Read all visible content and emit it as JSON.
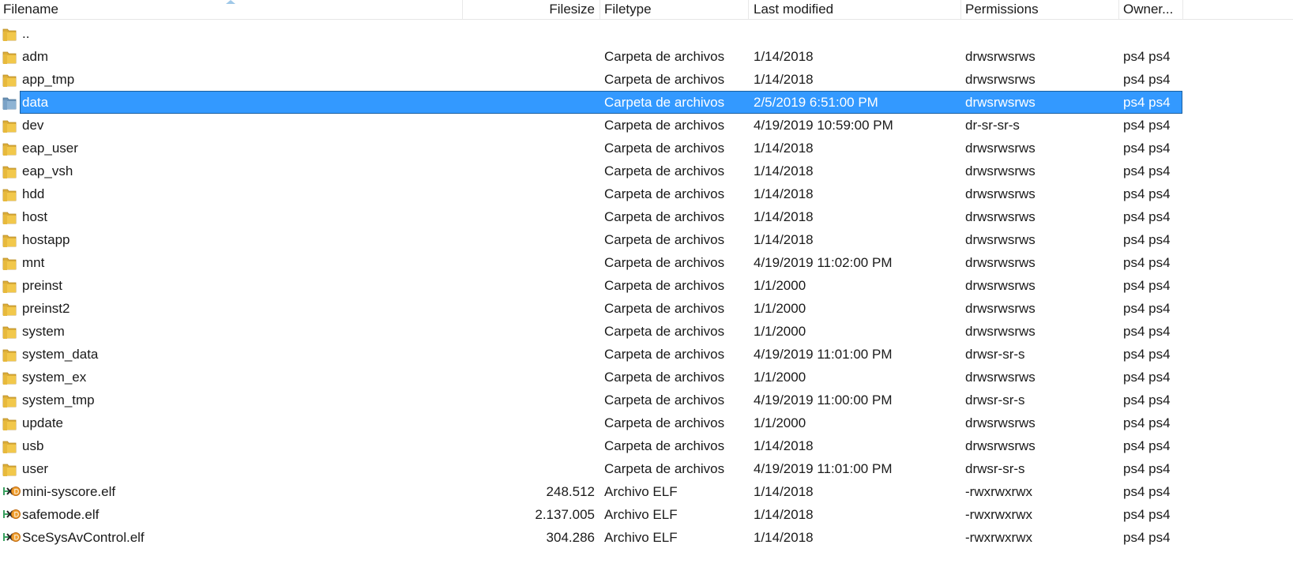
{
  "columns": {
    "filename": "Filename",
    "filesize": "Filesize",
    "filetype": "Filetype",
    "last_modified": "Last modified",
    "permissions": "Permissions",
    "owner": "Owner..."
  },
  "colors": {
    "selection": "#3399ff",
    "folder": "#f0c040"
  },
  "files": [
    {
      "name": "..",
      "size": "",
      "type": "",
      "modified": "",
      "permissions": "",
      "owner": "",
      "icon": "folder-icon",
      "selected": false
    },
    {
      "name": "adm",
      "size": "",
      "type": "Carpeta de archivos",
      "modified": "1/14/2018",
      "permissions": "drwsrwsrws",
      "owner": "ps4 ps4",
      "icon": "folder-icon",
      "selected": false
    },
    {
      "name": "app_tmp",
      "size": "",
      "type": "Carpeta de archivos",
      "modified": "1/14/2018",
      "permissions": "drwsrwsrws",
      "owner": "ps4 ps4",
      "icon": "folder-icon",
      "selected": false
    },
    {
      "name": "data",
      "size": "",
      "type": "Carpeta de archivos",
      "modified": "2/5/2019 6:51:00 PM",
      "permissions": "drwsrwsrws",
      "owner": "ps4 ps4",
      "icon": "folder-icon",
      "selected": true
    },
    {
      "name": "dev",
      "size": "",
      "type": "Carpeta de archivos",
      "modified": "4/19/2019 10:59:00 PM",
      "permissions": "dr-sr-sr-s",
      "owner": "ps4 ps4",
      "icon": "folder-icon",
      "selected": false
    },
    {
      "name": "eap_user",
      "size": "",
      "type": "Carpeta de archivos",
      "modified": "1/14/2018",
      "permissions": "drwsrwsrws",
      "owner": "ps4 ps4",
      "icon": "folder-icon",
      "selected": false
    },
    {
      "name": "eap_vsh",
      "size": "",
      "type": "Carpeta de archivos",
      "modified": "1/14/2018",
      "permissions": "drwsrwsrws",
      "owner": "ps4 ps4",
      "icon": "folder-icon",
      "selected": false
    },
    {
      "name": "hdd",
      "size": "",
      "type": "Carpeta de archivos",
      "modified": "1/14/2018",
      "permissions": "drwsrwsrws",
      "owner": "ps4 ps4",
      "icon": "folder-icon",
      "selected": false
    },
    {
      "name": "host",
      "size": "",
      "type": "Carpeta de archivos",
      "modified": "1/14/2018",
      "permissions": "drwsrwsrws",
      "owner": "ps4 ps4",
      "icon": "folder-icon",
      "selected": false
    },
    {
      "name": "hostapp",
      "size": "",
      "type": "Carpeta de archivos",
      "modified": "1/14/2018",
      "permissions": "drwsrwsrws",
      "owner": "ps4 ps4",
      "icon": "folder-icon",
      "selected": false
    },
    {
      "name": "mnt",
      "size": "",
      "type": "Carpeta de archivos",
      "modified": "4/19/2019 11:02:00 PM",
      "permissions": "drwsrwsrws",
      "owner": "ps4 ps4",
      "icon": "folder-icon",
      "selected": false
    },
    {
      "name": "preinst",
      "size": "",
      "type": "Carpeta de archivos",
      "modified": "1/1/2000",
      "permissions": "drwsrwsrws",
      "owner": "ps4 ps4",
      "icon": "folder-icon",
      "selected": false
    },
    {
      "name": "preinst2",
      "size": "",
      "type": "Carpeta de archivos",
      "modified": "1/1/2000",
      "permissions": "drwsrwsrws",
      "owner": "ps4 ps4",
      "icon": "folder-icon",
      "selected": false
    },
    {
      "name": "system",
      "size": "",
      "type": "Carpeta de archivos",
      "modified": "1/1/2000",
      "permissions": "drwsrwsrws",
      "owner": "ps4 ps4",
      "icon": "folder-icon",
      "selected": false
    },
    {
      "name": "system_data",
      "size": "",
      "type": "Carpeta de archivos",
      "modified": "4/19/2019 11:01:00 PM",
      "permissions": "drwsr-sr-s",
      "owner": "ps4 ps4",
      "icon": "folder-icon",
      "selected": false
    },
    {
      "name": "system_ex",
      "size": "",
      "type": "Carpeta de archivos",
      "modified": "1/1/2000",
      "permissions": "drwsrwsrws",
      "owner": "ps4 ps4",
      "icon": "folder-icon",
      "selected": false
    },
    {
      "name": "system_tmp",
      "size": "",
      "type": "Carpeta de archivos",
      "modified": "4/19/2019 11:00:00 PM",
      "permissions": "drwsr-sr-s",
      "owner": "ps4 ps4",
      "icon": "folder-icon",
      "selected": false
    },
    {
      "name": "update",
      "size": "",
      "type": "Carpeta de archivos",
      "modified": "1/1/2000",
      "permissions": "drwsrwsrws",
      "owner": "ps4 ps4",
      "icon": "folder-icon",
      "selected": false
    },
    {
      "name": "usb",
      "size": "",
      "type": "Carpeta de archivos",
      "modified": "1/14/2018",
      "permissions": "drwsrwsrws",
      "owner": "ps4 ps4",
      "icon": "folder-icon",
      "selected": false
    },
    {
      "name": "user",
      "size": "",
      "type": "Carpeta de archivos",
      "modified": "4/19/2019 11:01:00 PM",
      "permissions": "drwsr-sr-s",
      "owner": "ps4 ps4",
      "icon": "folder-icon",
      "selected": false
    },
    {
      "name": "mini-syscore.elf",
      "size": "248.512",
      "type": "Archivo ELF",
      "modified": "1/14/2018",
      "permissions": "-rwxrwxrwx",
      "owner": "ps4 ps4",
      "icon": "elf-file-icon",
      "selected": false
    },
    {
      "name": "safemode.elf",
      "size": "2.137.005",
      "type": "Archivo ELF",
      "modified": "1/14/2018",
      "permissions": "-rwxrwxrwx",
      "owner": "ps4 ps4",
      "icon": "elf-file-icon",
      "selected": false
    },
    {
      "name": "SceSysAvControl.elf",
      "size": "304.286",
      "type": "Archivo ELF",
      "modified": "1/14/2018",
      "permissions": "-rwxrwxrwx",
      "owner": "ps4 ps4",
      "icon": "elf-file-icon",
      "selected": false
    }
  ]
}
